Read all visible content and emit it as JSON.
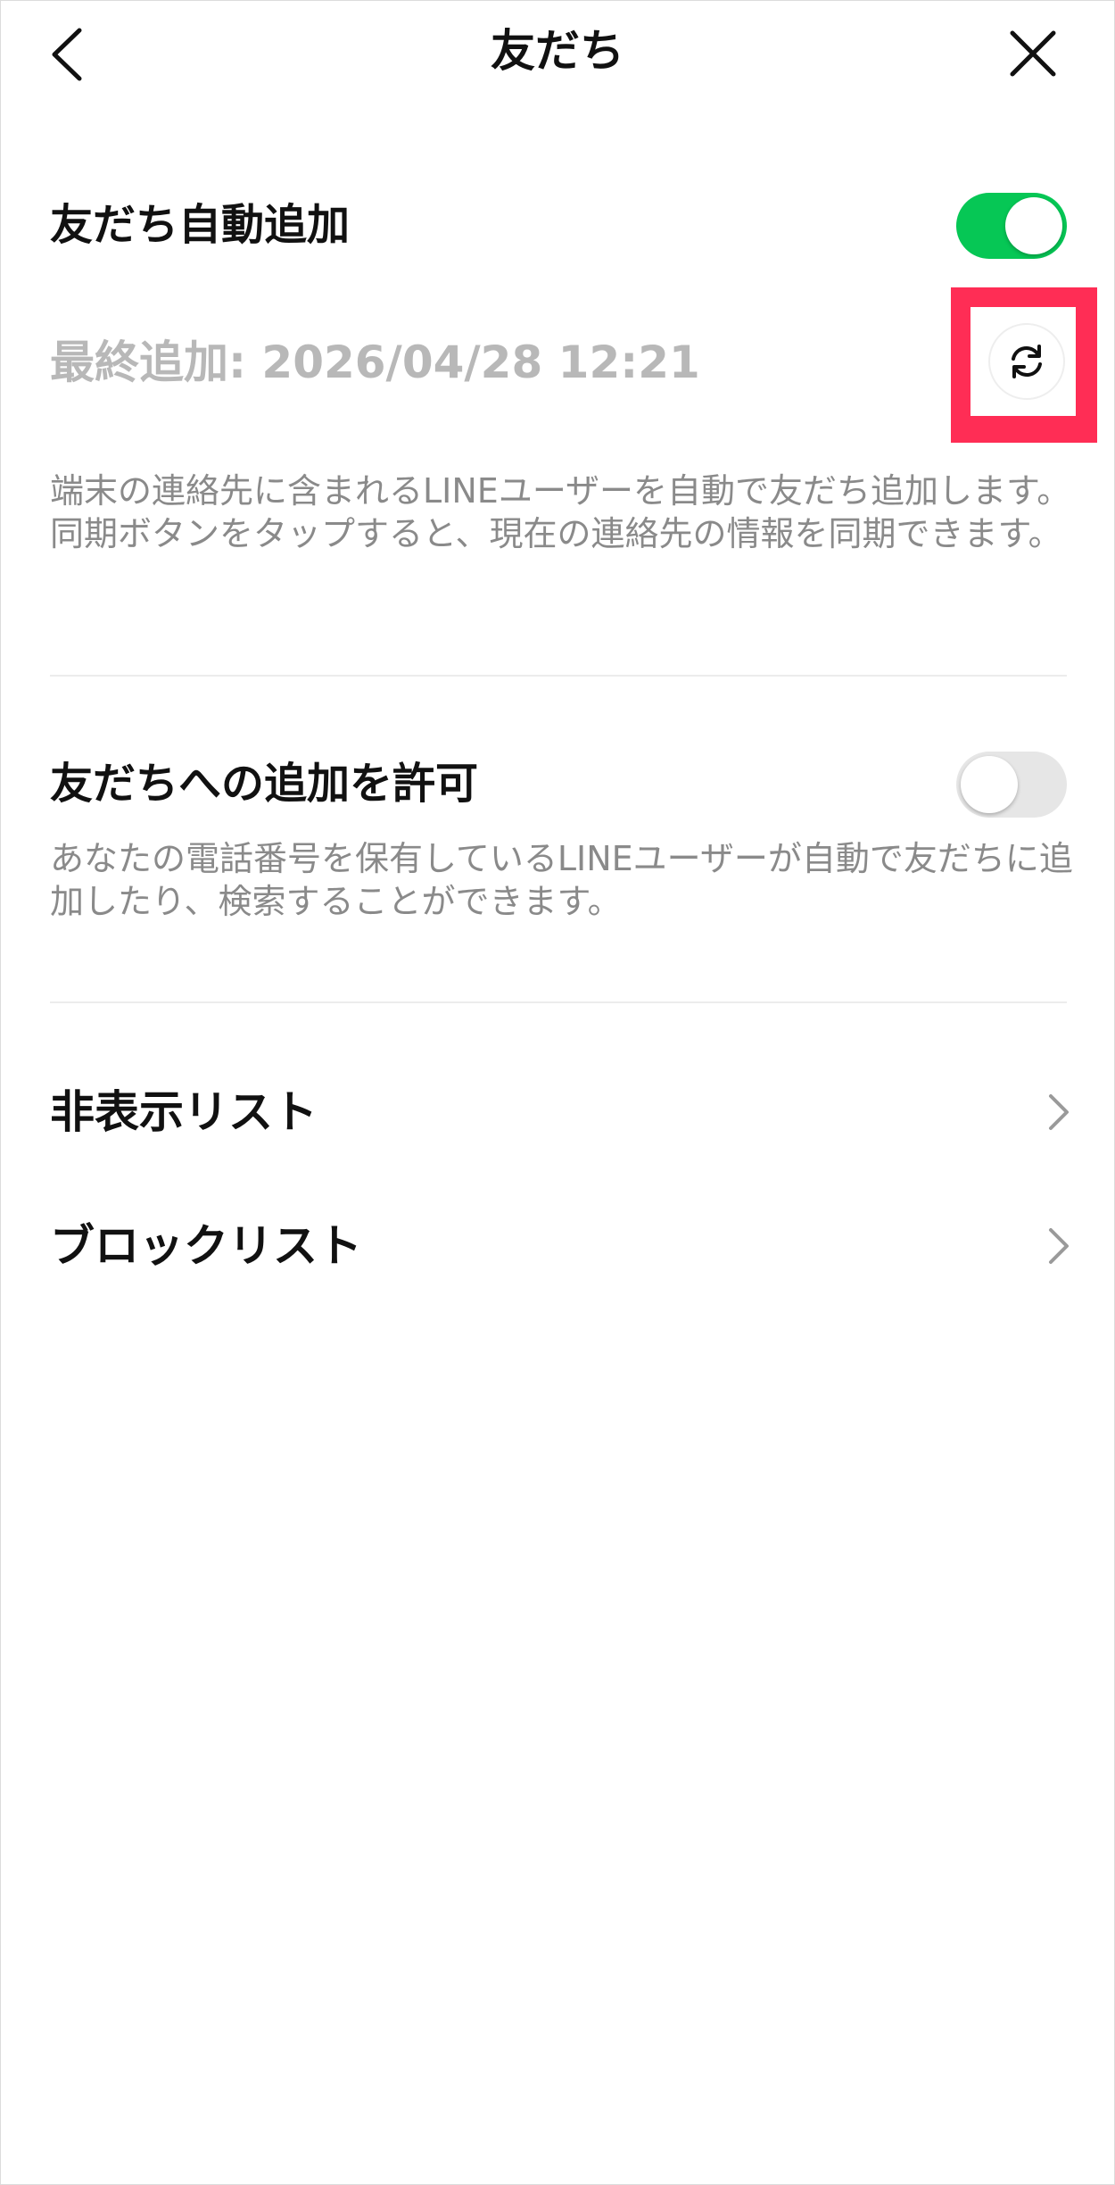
{
  "header": {
    "title": "友だち",
    "back_icon": "chevron-left-icon",
    "close_icon": "close-icon"
  },
  "auto_add": {
    "title": "友だち自動追加",
    "toggle_state": "on",
    "last_added": "最終追加: 2026/04/28 12:21",
    "sync_icon": "refresh-icon",
    "description": "端末の連絡先に含まれるLINEユーザーを自動で友だち追加します。同期ボタンをタップすると、現在の連絡先の情報を同期できます。"
  },
  "allow_add": {
    "title": "友だちへの追加を許可",
    "toggle_state": "off",
    "description": "あなたの電話番号を保有しているLINEユーザーが自動で友だちに追加したり、検索することができます。"
  },
  "lists": [
    {
      "label": "非表示リスト",
      "icon": "chevron-right-icon"
    },
    {
      "label": "ブロックリスト",
      "icon": "chevron-right-icon"
    }
  ],
  "colors": {
    "toggle_on": "#06c755",
    "toggle_off": "#e6e6e6",
    "highlight": "#ff2d55",
    "muted_text": "#8a8a8a",
    "timestamp_text": "#b8b8b8"
  }
}
